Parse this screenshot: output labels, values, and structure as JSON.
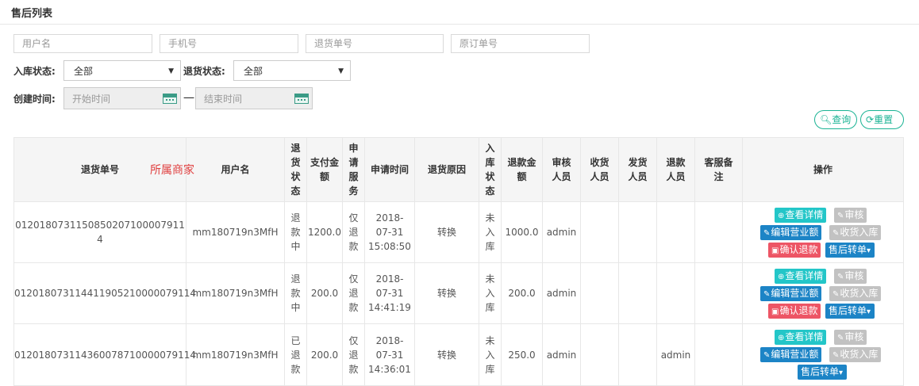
{
  "header": {
    "title": "售后列表"
  },
  "filters": {
    "username_placeholder": "用户名",
    "phone_placeholder": "手机号",
    "return_no_placeholder": "退货单号",
    "orig_order_placeholder": "原订单号",
    "stock_status_label": "入库状态:",
    "stock_status_value": "全部",
    "return_status_label": "退货状态:",
    "return_status_value": "全部",
    "created_label": "创建时间:",
    "start_placeholder": "开始时间",
    "end_placeholder": "结束时间",
    "dash": "一",
    "query_label": "查询",
    "reset_label": "重置"
  },
  "overlay": {
    "merchant": "所属商家"
  },
  "table": {
    "headers": {
      "return_no": "退货单号",
      "username": "用户名",
      "return_status": "退\n货\n状\n态",
      "paid": "支付金\n额",
      "service": "申\n请\n服\n务",
      "apply_time": "申请时间",
      "reason": "退货原因",
      "stock": "入\n库\n状\n态",
      "refund": "退款金\n额",
      "auditor": "审核\n人员",
      "receiver": "收货\n人员",
      "shipper": "发货\n人员",
      "refunder": "退款\n人员",
      "remark": "客服备\n注",
      "ops": "操作"
    },
    "rows": [
      {
        "return_no": "0120180731150850207100007911​4",
        "username": "mm180719n3MfH",
        "status": "退\n款\n中",
        "paid": "1200.0",
        "service": "仅\n退\n款",
        "time": "2018-\n07-31\n15:08:50",
        "reason": "转换",
        "stock": "未\n入\n库",
        "refund": "1000.0",
        "auditor": "admin",
        "receiver": "",
        "shipper": "",
        "refunder": "",
        "remark": ""
      },
      {
        "return_no": "012018073114411905210000079114",
        "username": "mm180719n3MfH",
        "status": "退\n款\n中",
        "paid": "200.0",
        "service": "仅\n退\n款",
        "time": "2018-\n07-31\n14:41:19",
        "reason": "转换",
        "stock": "未\n入\n库",
        "refund": "200.0",
        "auditor": "admin",
        "receiver": "",
        "shipper": "",
        "refunder": "",
        "remark": ""
      },
      {
        "return_no": "012018073114360078710000079114",
        "username": "mm180719n3MfH",
        "status": "已\n退\n款",
        "paid": "200.0",
        "service": "仅\n退\n款",
        "time": "2018-\n07-31\n14:36:01",
        "reason": "转换",
        "stock": "未\n入\n库",
        "refund": "250.0",
        "auditor": "admin",
        "receiver": "",
        "shipper": "",
        "refunder": "admin",
        "remark": ""
      }
    ],
    "actions": {
      "view": "查看详情",
      "audit": "审核",
      "edit_revenue": "编辑营业额",
      "receive_stock": "收货入库",
      "confirm_refund": "确认退款",
      "transfer": "售后转单"
    }
  },
  "colors": {
    "accent": "#1ab394",
    "info": "#23c6c8",
    "primary": "#1c84c6",
    "danger": "#ed5565",
    "disabled": "#c2c2c2"
  }
}
